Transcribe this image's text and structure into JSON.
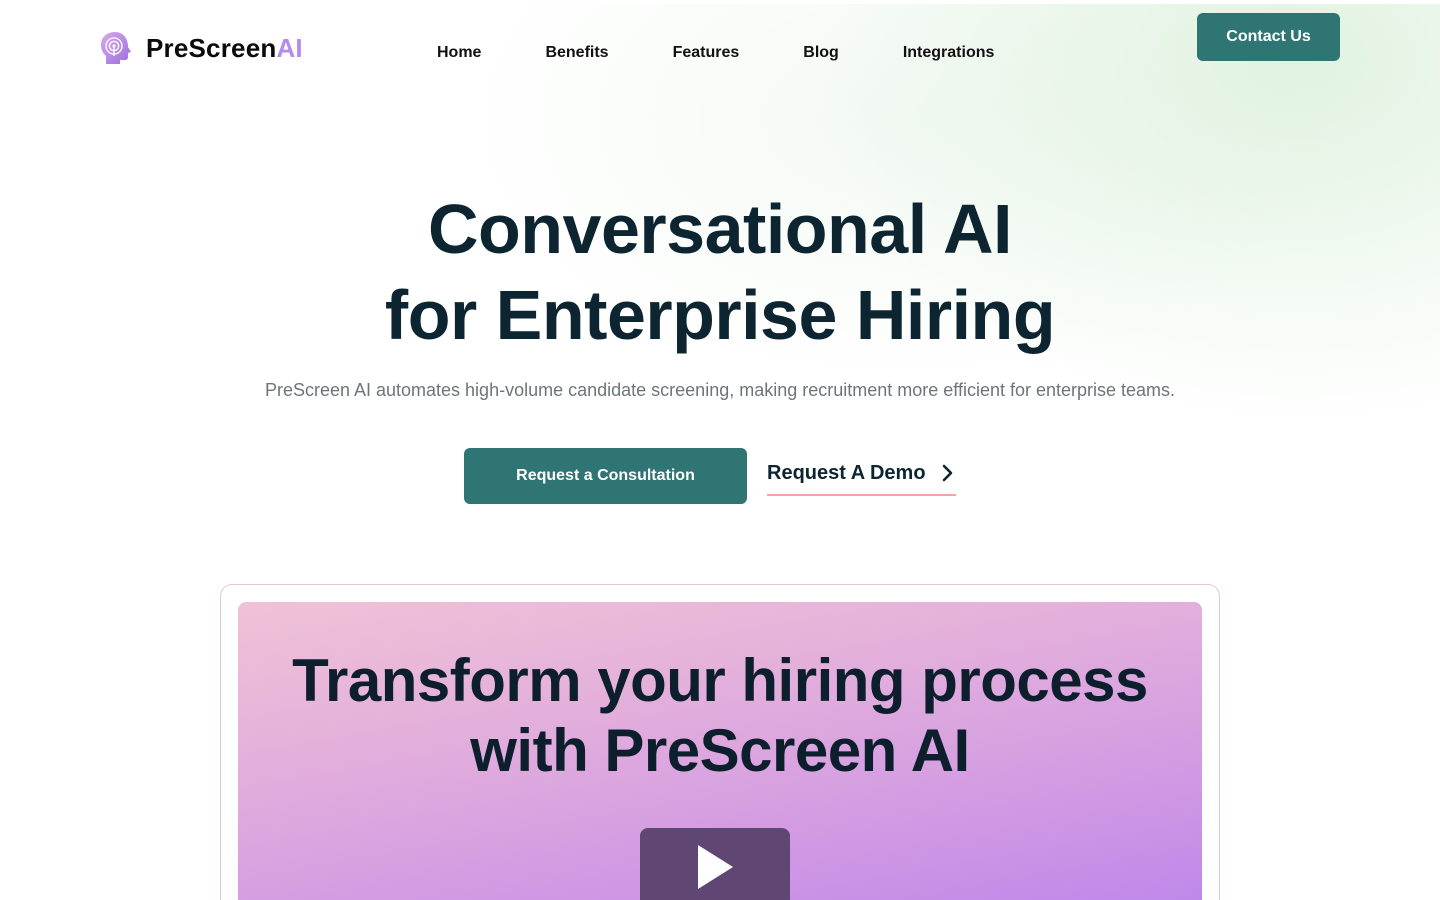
{
  "brand": {
    "name_primary": "PreScreen",
    "name_accent": "AI",
    "accent_color": "#b68ce6",
    "icon": "head-signal-icon"
  },
  "nav": {
    "items": [
      {
        "label": "Home"
      },
      {
        "label": "Benefits"
      },
      {
        "label": "Features"
      },
      {
        "label": "Blog"
      },
      {
        "label": "Integrations"
      }
    ]
  },
  "header": {
    "contact_label": "Contact Us"
  },
  "hero": {
    "title_line1": "Conversational AI",
    "title_line2": "for Enterprise Hiring",
    "subtitle": "PreScreen AI automates high-volume candidate screening, making recruitment more efficient for enterprise teams.",
    "primary_cta": "Request a Consultation",
    "secondary_cta": "Request A Demo"
  },
  "video": {
    "title_line1": "Transform your hiring process",
    "title_line2": "with PreScreen AI",
    "play_icon": "play-icon"
  },
  "colors": {
    "primary": "#2f7574",
    "text_dark": "#0d2530",
    "demo_underline": "#f0a6a6"
  }
}
